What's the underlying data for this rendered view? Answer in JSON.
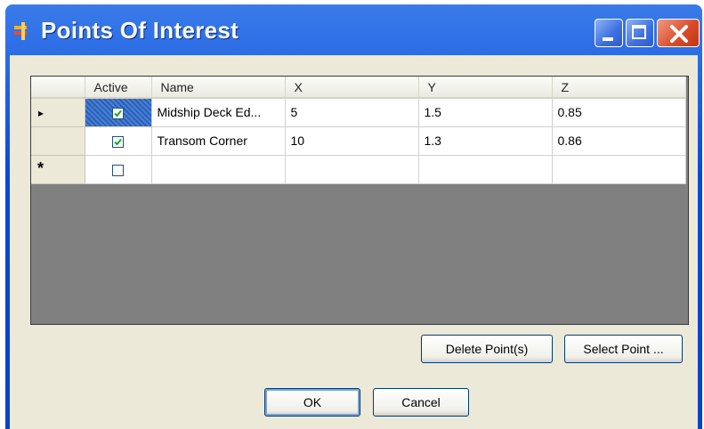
{
  "window": {
    "title": "Points Of Interest",
    "icon": "app-window-icon",
    "controls": [
      "minimize-icon",
      "maximize-icon",
      "close-icon"
    ]
  },
  "grid": {
    "columns": [
      "Active",
      "Name",
      "X",
      "Y",
      "Z"
    ],
    "rows": [
      {
        "marker": "current-row-icon",
        "active": true,
        "name": "Midship Deck Ed...",
        "x": "5",
        "y": "1.5",
        "z": "0.85"
      },
      {
        "marker": "",
        "active": true,
        "name": "Transom Corner",
        "x": "10",
        "y": "1.3",
        "z": "0.86"
      },
      {
        "marker": "new-row-icon",
        "active": false,
        "name": "",
        "x": "",
        "y": "",
        "z": ""
      }
    ],
    "row_markers": {
      "current": "▸",
      "new": "*"
    }
  },
  "buttons": {
    "delete": "Delete Point(s)",
    "select": "Select Point ...",
    "ok": "OK",
    "cancel": "Cancel"
  },
  "colors": {
    "titlebar": "#0a49d8",
    "dialog_bg": "#ece9d8",
    "grid_empty": "#808080",
    "selection": "#316ac5",
    "check": "#21a121"
  }
}
